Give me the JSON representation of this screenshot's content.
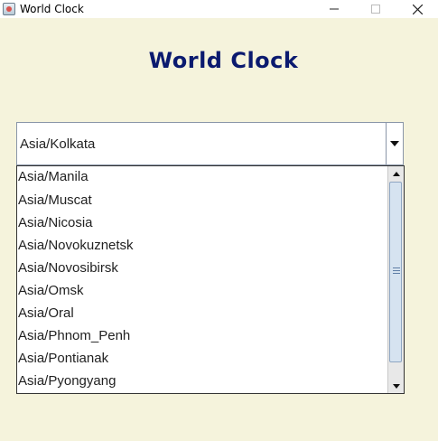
{
  "window": {
    "title": "World Clock",
    "icon": "java-coffee-icon"
  },
  "heading": "World Clock",
  "timezone_select": {
    "selected": "Asia/Kolkata"
  },
  "dropdown": {
    "items": [
      "Asia/Manila",
      "Asia/Muscat",
      "Asia/Nicosia",
      "Asia/Novokuznetsk",
      "Asia/Novosibirsk",
      "Asia/Omsk",
      "Asia/Oral",
      "Asia/Phnom_Penh",
      "Asia/Pontianak",
      "Asia/Pyongyang"
    ]
  },
  "colors": {
    "background": "#f5f3dc",
    "heading": "#0b1a6f"
  }
}
